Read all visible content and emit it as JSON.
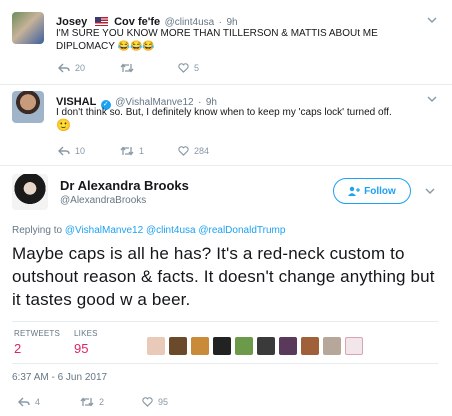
{
  "reply1": {
    "name": "Josey",
    "name_suffix": "Cov fe'fe",
    "handle": "@clint4usa",
    "time": "9h",
    "text": "I'M SURE YOU KNOW MORE THAN TILLERSON & MATTIS ABOUt ME DIPLOMACY",
    "emoji": "😂😂😂",
    "replies": "20",
    "retweets": "",
    "likes": "5"
  },
  "reply2": {
    "name": "VISHAL",
    "handle": "@VishalManve12",
    "time": "9h",
    "text": "I don't think so. But, I definitely know when to keep my 'caps lock' turned off.",
    "emoji": "🙂",
    "replies": "10",
    "retweets": "1",
    "likes": "284"
  },
  "main": {
    "name": "Dr Alexandra Brooks",
    "handle": "@AlexandraBrooks",
    "follow_label": "Follow",
    "replying_to_label": "Replying to",
    "replying_to": [
      "@VishalManve12",
      "@clint4usa",
      "@realDonaldTrump"
    ],
    "text": "Maybe caps is all he has? It's a red-neck custom to outshout reason & facts. It doesn't change anything but it tastes good w a beer.",
    "stats": {
      "retweets_label": "RETWEETS",
      "retweets": "2",
      "likes_label": "LIKES",
      "likes": "95"
    },
    "timestamp": "6:37 AM - 6 Jun 2017",
    "actions": {
      "replies": "4",
      "retweets": "2",
      "likes": "95"
    }
  },
  "colors": {
    "accent": "#1da1f2",
    "muted": "#657786",
    "icon": "#8899a6",
    "liked_count": "#e0245e"
  }
}
